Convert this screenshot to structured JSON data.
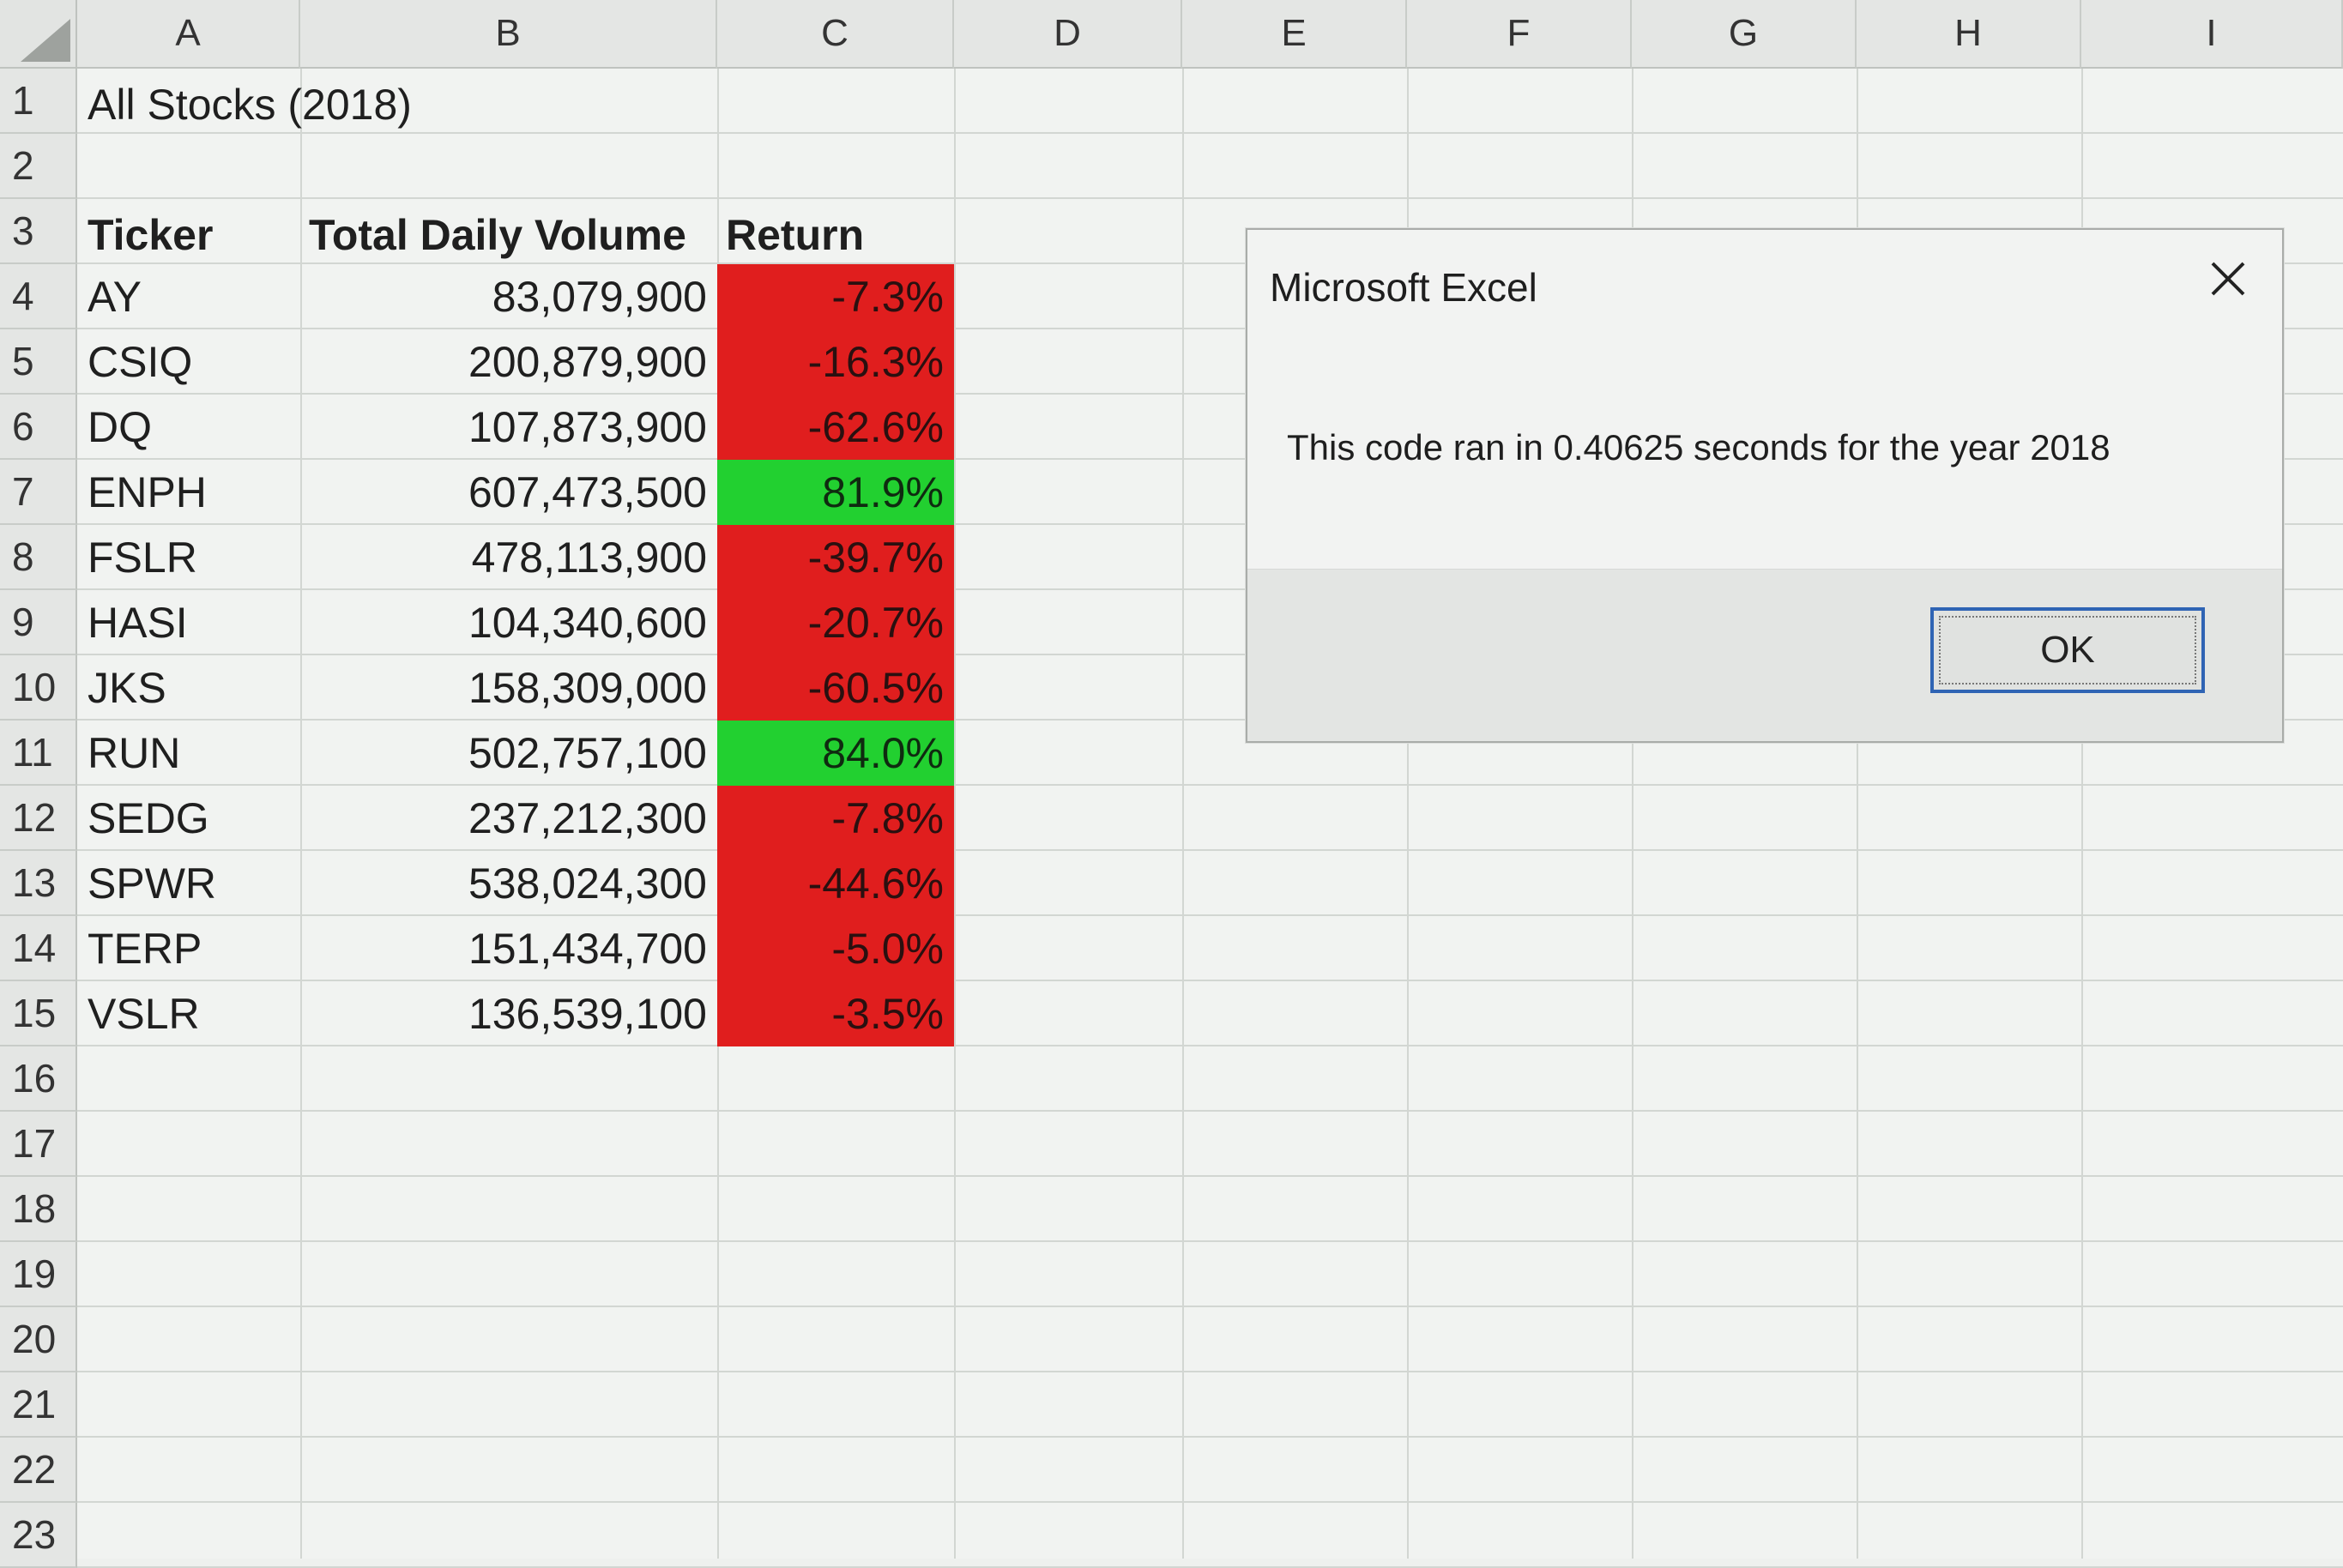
{
  "columns": [
    "A",
    "B",
    "C",
    "D",
    "E",
    "F",
    "G",
    "H",
    "I"
  ],
  "rows": [
    "1",
    "2",
    "3",
    "4",
    "5",
    "6",
    "7",
    "8",
    "9",
    "10",
    "11",
    "12",
    "13",
    "14",
    "15",
    "16",
    "17",
    "18",
    "19",
    "20",
    "21",
    "22",
    "23"
  ],
  "sheet": {
    "title": "All Stocks (2018)",
    "headers": {
      "ticker": "Ticker",
      "volume": "Total Daily Volume",
      "return": "Return"
    },
    "table": [
      {
        "ticker": "AY",
        "volume": "83,079,900",
        "return": "-7.3%",
        "status": "negative"
      },
      {
        "ticker": "CSIQ",
        "volume": "200,879,900",
        "return": "-16.3%",
        "status": "negative"
      },
      {
        "ticker": "DQ",
        "volume": "107,873,900",
        "return": "-62.6%",
        "status": "negative"
      },
      {
        "ticker": "ENPH",
        "volume": "607,473,500",
        "return": "81.9%",
        "status": "positive"
      },
      {
        "ticker": "FSLR",
        "volume": "478,113,900",
        "return": "-39.7%",
        "status": "negative"
      },
      {
        "ticker": "HASI",
        "volume": "104,340,600",
        "return": "-20.7%",
        "status": "negative"
      },
      {
        "ticker": "JKS",
        "volume": "158,309,000",
        "return": "-60.5%",
        "status": "negative"
      },
      {
        "ticker": "RUN",
        "volume": "502,757,100",
        "return": "84.0%",
        "status": "positive"
      },
      {
        "ticker": "SEDG",
        "volume": "237,212,300",
        "return": "-7.8%",
        "status": "negative"
      },
      {
        "ticker": "SPWR",
        "volume": "538,024,300",
        "return": "-44.6%",
        "status": "negative"
      },
      {
        "ticker": "TERP",
        "volume": "151,434,700",
        "return": "-5.0%",
        "status": "negative"
      },
      {
        "ticker": "VSLR",
        "volume": "136,539,100",
        "return": "-3.5%",
        "status": "negative"
      }
    ]
  },
  "colors": {
    "negative": "#e01e1e",
    "positive": "#22d030",
    "button_border": "#2f64b4"
  },
  "dialog": {
    "title": "Microsoft Excel",
    "close_icon": "close-icon",
    "message": "This code ran in 0.40625 seconds for the year 2018",
    "ok_label": "OK"
  }
}
